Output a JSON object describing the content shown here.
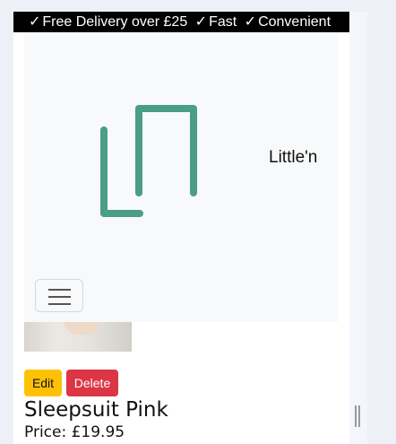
{
  "promo": {
    "items": [
      "Free Delivery over £25",
      "Fast",
      "Convenient"
    ],
    "check_icon": "✓"
  },
  "brand": {
    "name": "Little'n"
  },
  "colors": {
    "logo": "#4a9e86",
    "edit": "#ffc107",
    "delete": "#dc3545",
    "promo_bg": "#000000"
  },
  "icons": {
    "logo": "brand-logo-icon",
    "menu": "hamburger-menu-icon",
    "check": "check-icon"
  },
  "product": {
    "name": "Sleepsuit Pink",
    "price": "Price: £19.95",
    "edit_label": "Edit",
    "delete_label": "Delete"
  }
}
